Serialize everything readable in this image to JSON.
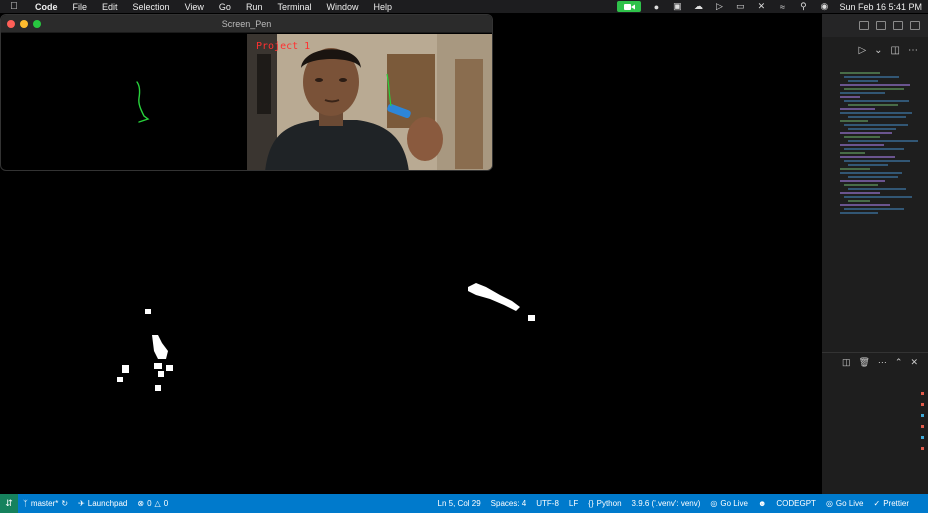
{
  "menubar": {
    "items": [
      "Code",
      "File",
      "Edit",
      "Selection",
      "View",
      "Go",
      "Run",
      "Terminal",
      "Window",
      "Help"
    ],
    "clock": "Sun Feb 16  5:41 PM"
  },
  "pen_window": {
    "title": "Screen_Pen",
    "caption": "Project 1"
  },
  "statusbar": {
    "branch": "master*",
    "launchpad": "Launchpad",
    "problems": "0",
    "warnings": "0",
    "cursor": "Ln 5, Col 29",
    "spaces": "Spaces: 4",
    "encoding": "UTF-8",
    "eol": "LF",
    "language": "Python",
    "interpreter": "3.9.6 ('.venv': venv)",
    "go_live": "Go Live",
    "codegpt": "CODEGPT",
    "go_live_2": "Go Live",
    "prettier": "Prettier"
  },
  "colors": {
    "status_bg": "#007acc",
    "record": "#2fc24a",
    "pen_stroke": "#28d23c",
    "caption": "#ff3030"
  }
}
